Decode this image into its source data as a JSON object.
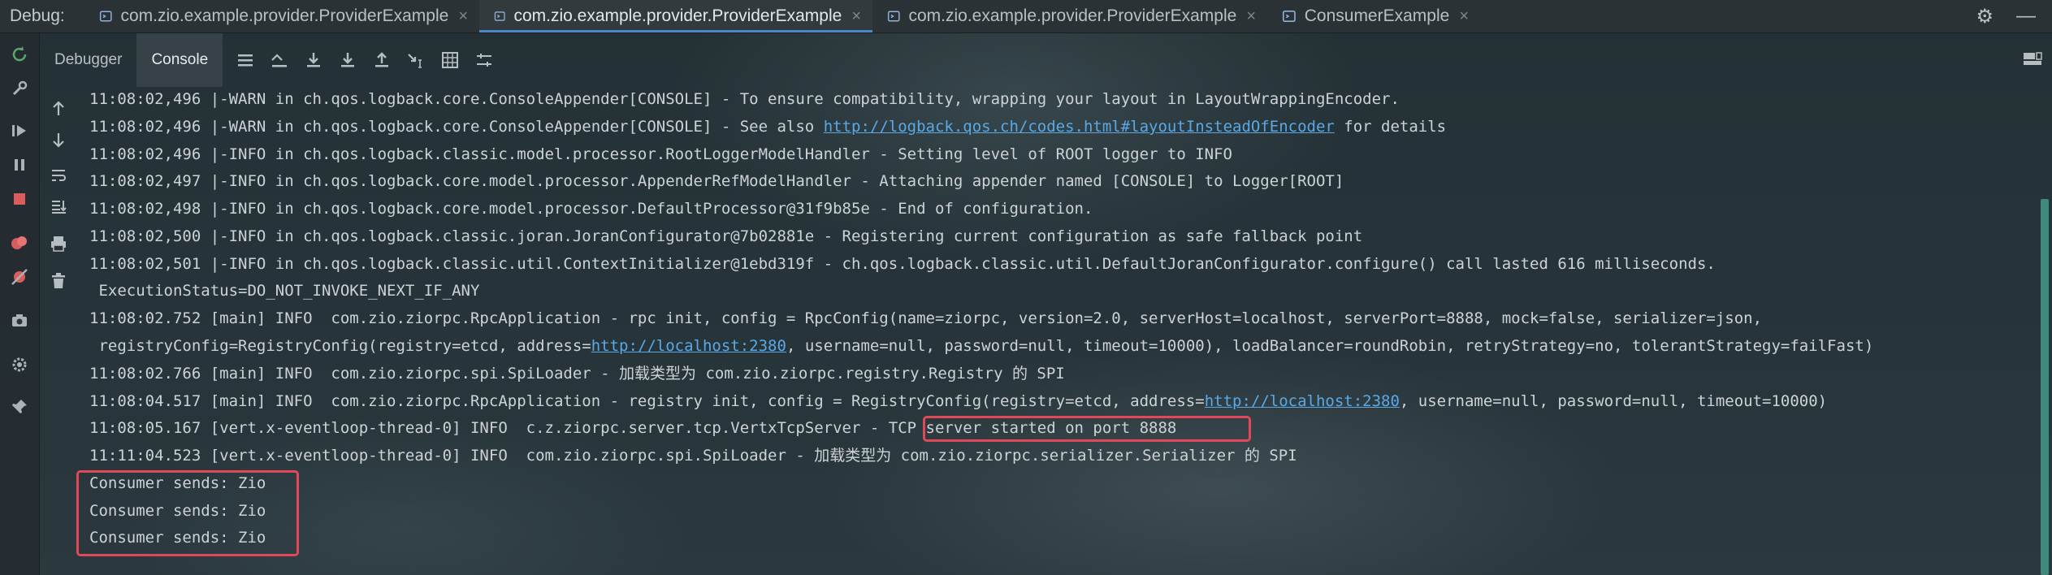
{
  "topbar": {
    "debug_label": "Debug:",
    "tabs": [
      {
        "label": "com.zio.example.provider.ProviderExample",
        "active": false
      },
      {
        "label": "com.zio.example.provider.ProviderExample",
        "active": true
      },
      {
        "label": "com.zio.example.provider.ProviderExample",
        "active": false
      },
      {
        "label": "ConsumerExample",
        "active": false
      }
    ],
    "close_glyph": "×",
    "settings_glyph": "⚙",
    "minimize_glyph": "—"
  },
  "subbar": {
    "debugger_label": "Debugger",
    "console_label": "Console"
  },
  "console": {
    "lines": [
      {
        "pre": "11:08:02,496 |-WARN in ch.qos.logback.core.ConsoleAppender[CONSOLE] - To ensure compatibility, wrapping your layout in LayoutWrappingEncoder.",
        "link": "",
        "post": ""
      },
      {
        "pre": "11:08:02,496 |-WARN in ch.qos.logback.core.ConsoleAppender[CONSOLE] - See also ",
        "link": "http://logback.qos.ch/codes.html#layoutInsteadOfEncoder",
        "post": " for details"
      },
      {
        "pre": "11:08:02,496 |-INFO in ch.qos.logback.classic.model.processor.RootLoggerModelHandler - Setting level of ROOT logger to INFO",
        "link": "",
        "post": ""
      },
      {
        "pre": "11:08:02,497 |-INFO in ch.qos.logback.core.model.processor.AppenderRefModelHandler - Attaching appender named [CONSOLE] to Logger[ROOT]",
        "link": "",
        "post": ""
      },
      {
        "pre": "11:08:02,498 |-INFO in ch.qos.logback.core.model.processor.DefaultProcessor@31f9b85e - End of configuration.",
        "link": "",
        "post": ""
      },
      {
        "pre": "11:08:02,500 |-INFO in ch.qos.logback.classic.joran.JoranConfigurator@7b02881e - Registering current configuration as safe fallback point",
        "link": "",
        "post": ""
      },
      {
        "pre": "11:08:02,501 |-INFO in ch.qos.logback.classic.util.ContextInitializer@1ebd319f - ch.qos.logback.classic.util.DefaultJoranConfigurator.configure() call lasted 616 milliseconds.",
        "link": "",
        "post": ""
      },
      {
        "pre": " ExecutionStatus=DO_NOT_INVOKE_NEXT_IF_ANY",
        "link": "",
        "post": ""
      },
      {
        "pre": "11:08:02.752 [main] INFO  com.zio.ziorpc.RpcApplication - rpc init, config = RpcConfig(name=ziorpc, version=2.0, serverHost=localhost, serverPort=8888, mock=false, serializer=json,",
        "link": "",
        "post": ""
      },
      {
        "pre": " registryConfig=RegistryConfig(registry=etcd, address=",
        "link": "http://localhost:2380",
        "post": ", username=null, password=null, timeout=10000), loadBalancer=roundRobin, retryStrategy=no, tolerantStrategy=failFast)"
      },
      {
        "pre": "11:08:02.766 [main] INFO  com.zio.ziorpc.spi.SpiLoader - 加载类型为 com.zio.ziorpc.registry.Registry 的 SPI",
        "link": "",
        "post": ""
      },
      {
        "pre": "11:08:04.517 [main] INFO  com.zio.ziorpc.RpcApplication - registry init, config = RegistryConfig(registry=etcd, address=",
        "link": "http://localhost:2380",
        "post": ", username=null, password=null, timeout=10000)"
      },
      {
        "pre": "11:08:05.167 [vert.x-eventloop-thread-0] INFO  c.z.ziorpc.server.tcp.VertxTcpServer - TCP server started on port 8888",
        "link": "",
        "post": ""
      },
      {
        "pre": "11:11:04.523 [vert.x-eventloop-thread-0] INFO  com.zio.ziorpc.spi.SpiLoader - 加载类型为 com.zio.ziorpc.serializer.Serializer 的 SPI",
        "link": "",
        "post": ""
      },
      {
        "pre": "Consumer sends: Zio",
        "link": "",
        "post": ""
      },
      {
        "pre": "Consumer sends: Zio",
        "link": "",
        "post": ""
      },
      {
        "pre": "Consumer sends: Zio",
        "link": "",
        "post": ""
      }
    ]
  },
  "colors": {
    "accent": "#4a88c7",
    "highlight": "#e1485a",
    "link": "#5aa9e6",
    "scroll": "#3f8a7a"
  }
}
